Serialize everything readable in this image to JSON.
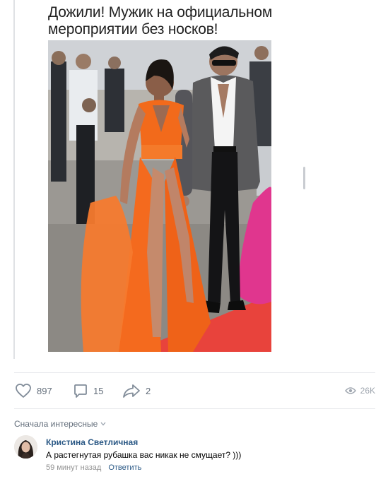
{
  "post": {
    "meme_title": "Дожили! Мужик на официальном мероприятии без носков!"
  },
  "actions": {
    "likes": "897",
    "comments": "15",
    "shares": "2",
    "views": "26K"
  },
  "comments_section": {
    "sort_label": "Сначала интересные",
    "items": [
      {
        "author": "Кристина Светличная",
        "text": "А растегнутая рубашка вас никак не смущает? )))",
        "time": "59 минут назад",
        "reply_label": "Ответить"
      }
    ]
  },
  "icons": {
    "like": "heart-icon",
    "comment": "comment-bubble-icon",
    "share": "share-arrow-icon",
    "views": "eye-icon",
    "sort": "chevron-down-icon"
  },
  "colors": {
    "link": "#2a5885",
    "icon_gray": "#818c99",
    "dress_orange": "#f26a1b",
    "carpet_red": "#e8433c"
  }
}
